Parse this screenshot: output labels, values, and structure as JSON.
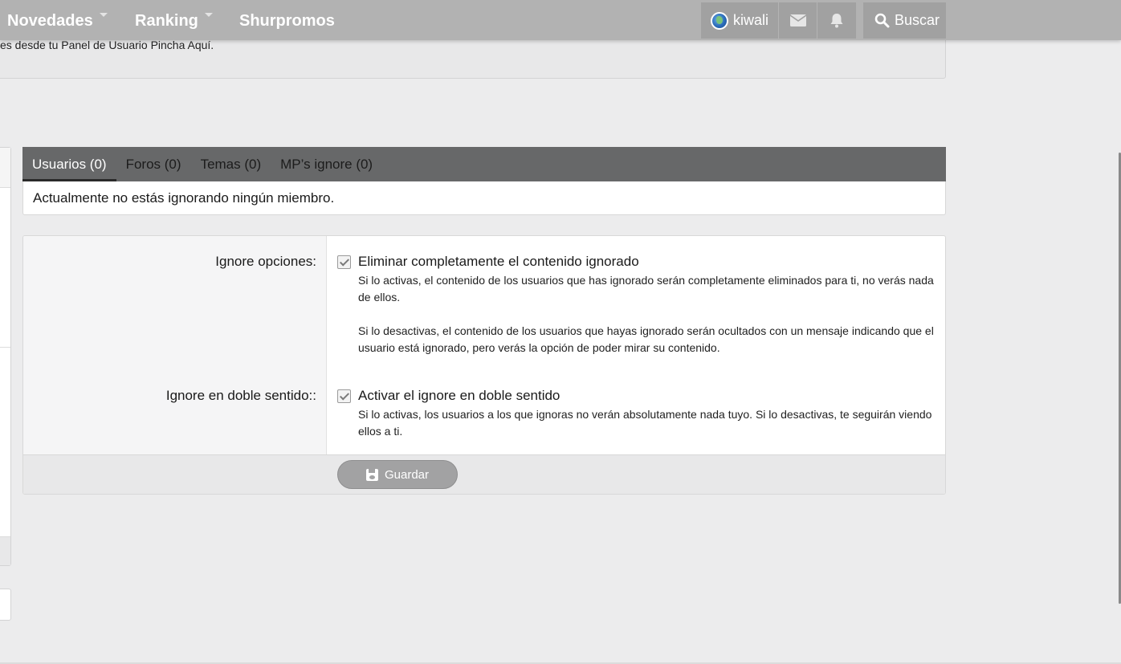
{
  "nav": {
    "items": [
      {
        "label": "Novedades",
        "has_dropdown": true
      },
      {
        "label": "Ranking",
        "has_dropdown": true
      },
      {
        "label": "Shurpromos",
        "has_dropdown": false
      }
    ],
    "user": {
      "name": "kiwali",
      "avatar_icon": "globe-avatar-icon"
    },
    "icons": [
      "envelope-icon",
      "bell-icon"
    ],
    "search_label": "Buscar"
  },
  "notice": {
    "text": "es desde tu Panel de Usuario Pincha Aquí."
  },
  "tabs": [
    {
      "label": "Usuarios (0)",
      "active": true
    },
    {
      "label": "Foros (0)",
      "active": false
    },
    {
      "label": "Temas (0)",
      "active": false
    },
    {
      "label": "MP’s ignore (0)",
      "active": false
    }
  ],
  "tab_content": "Actualmente no estás ignorando ningún miembro.",
  "options": [
    {
      "label": "Ignore opciones:",
      "checkbox_label": "Eliminar completamente el contenido ignorado",
      "checked": true,
      "hints": [
        "Si lo activas, el contenido de los usuarios que has ignorado serán completamente eliminados para ti, no verás nada de ellos.",
        "Si lo desactivas, el contenido de los usuarios que hayas ignorado serán ocultados con un mensaje indicando que el usuario está ignorado, pero verás la opción de poder mirar su contenido."
      ]
    },
    {
      "label": "Ignore en doble sentido::",
      "checkbox_label": "Activar el ignore en doble sentido",
      "checked": true,
      "hints": [
        "Si lo activas, los usuarios a los que ignoras no verán absolutamente nada tuyo. Si lo desactivas, te seguirán viendo ellos a ti."
      ]
    }
  ],
  "save_label": "Guardar",
  "colors": {
    "topbar": "#b2b2b2",
    "tabbar": "#676869",
    "button": "#a2a2a3",
    "background": "#ececed"
  }
}
